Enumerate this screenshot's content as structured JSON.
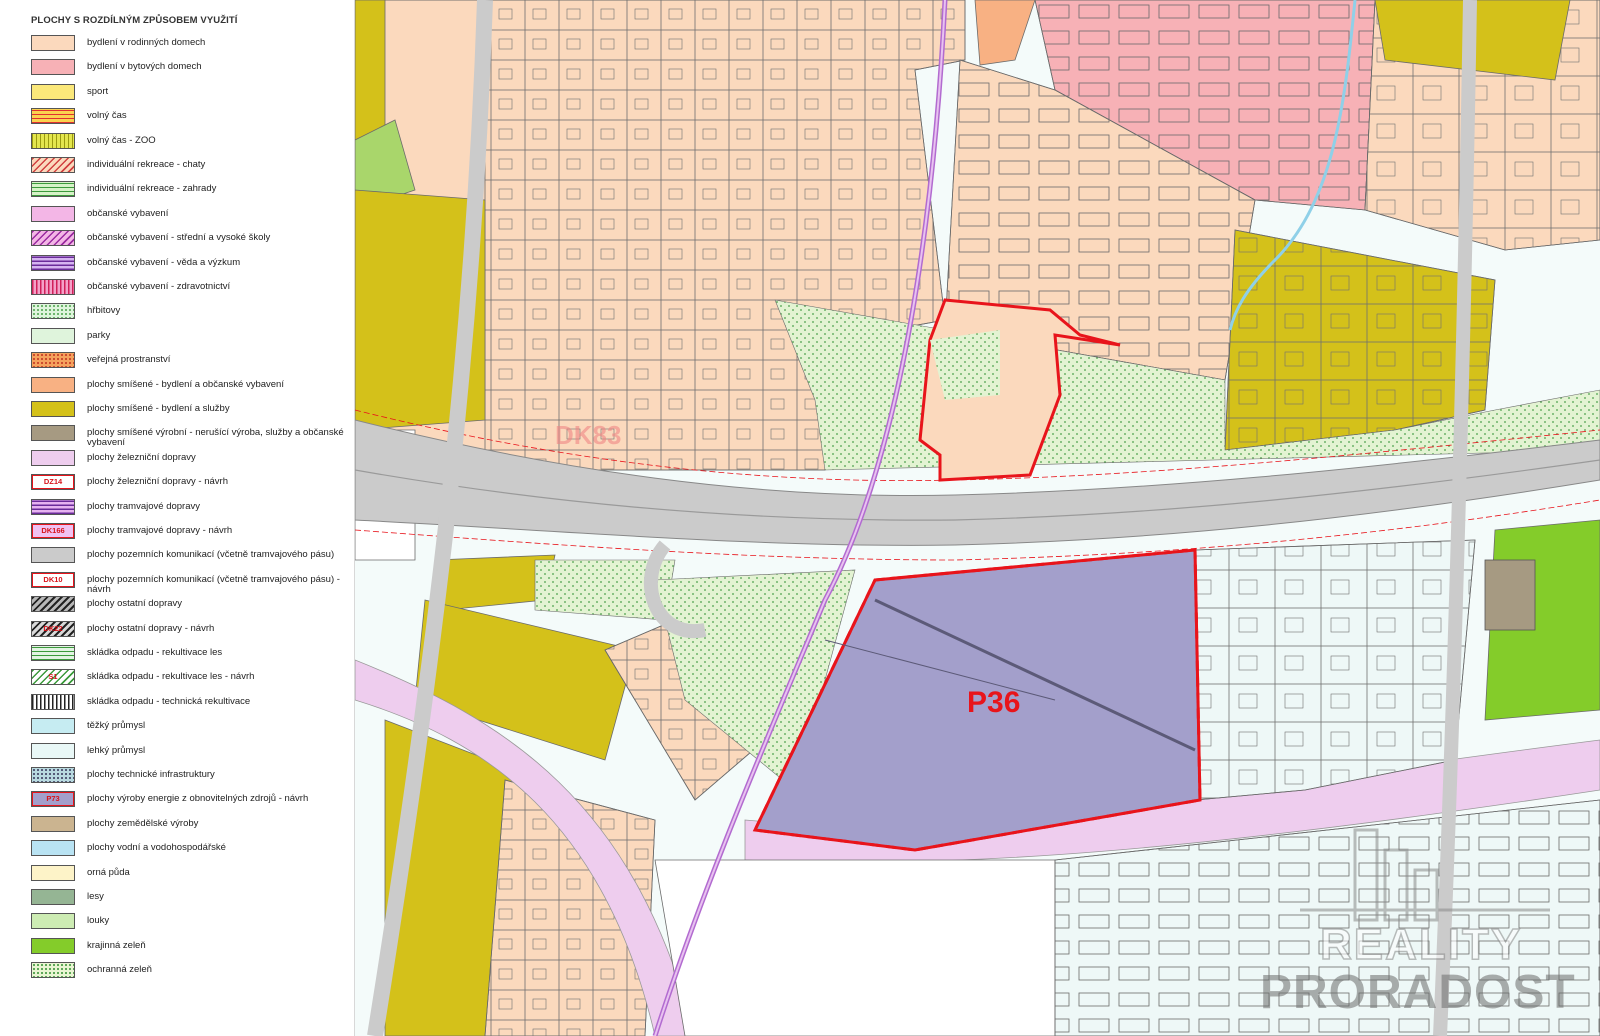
{
  "legend": {
    "title": "PLOCHY S ROZDÍLNÝM ZPŮSOBEM VYUŽITÍ",
    "items": [
      {
        "label": "bydlení v rodinných domech",
        "fill": "#fbd9bd",
        "pattern": "none",
        "code": ""
      },
      {
        "label": "bydlení v bytových domech",
        "fill": "#f7b1b6",
        "pattern": "none",
        "code": ""
      },
      {
        "label": "sport",
        "fill": "#fbe87a",
        "pattern": "none",
        "code": ""
      },
      {
        "label": "volný čas",
        "fill": "#fbd24f",
        "pattern": "hstripe-red",
        "code": ""
      },
      {
        "label": "volný čas - ZOO",
        "fill": "#e4e64e",
        "pattern": "vstripe",
        "code": ""
      },
      {
        "label": "individuální rekreace - chaty",
        "fill": "#fbd9bd",
        "pattern": "diag-red",
        "code": ""
      },
      {
        "label": "individuální rekreace - zahrady",
        "fill": "#d6f2c7",
        "pattern": "hstripe-green",
        "code": ""
      },
      {
        "label": "občanské vybavení",
        "fill": "#f3b6e6",
        "pattern": "none",
        "code": ""
      },
      {
        "label": "občanské vybavení - střední a vysoké školy",
        "fill": "#f3b6e6",
        "pattern": "diag-purple",
        "code": ""
      },
      {
        "label": "občanské vybavení - věda a výzkum",
        "fill": "#d5b3f0",
        "pattern": "hstripe-purple",
        "code": ""
      },
      {
        "label": "občanské vybavení  - zdravotnictví",
        "fill": "#f4a1c8",
        "pattern": "vstripe-red",
        "code": ""
      },
      {
        "label": "hřbitovy",
        "fill": "#dff4dc",
        "pattern": "dots",
        "code": ""
      },
      {
        "label": "parky",
        "fill": "#dff4dc",
        "pattern": "none",
        "code": ""
      },
      {
        "label": "veřejná prostranství",
        "fill": "#f5a25d",
        "pattern": "dots-red",
        "code": ""
      },
      {
        "label": "plochy smíšené - bydlení a občanské vybavení",
        "fill": "#f8b183",
        "pattern": "none",
        "code": ""
      },
      {
        "label": "plochy smíšené - bydlení a služby",
        "fill": "#d4c11a",
        "pattern": "none",
        "code": ""
      },
      {
        "label": "plochy smíšené výrobní - nerušící výroba, služby a občanské vybavení",
        "fill": "#a69a82",
        "pattern": "none",
        "code": ""
      },
      {
        "label": "plochy železniční dopravy",
        "fill": "#eecdee",
        "pattern": "none",
        "code": ""
      },
      {
        "label": "plochy železniční dopravy - návrh",
        "fill": "#ffffff",
        "pattern": "border-red",
        "code": "DZ14"
      },
      {
        "label": "plochy tramvajové dopravy",
        "fill": "#e6b2f0",
        "pattern": "hstripe-purple",
        "code": ""
      },
      {
        "label": "plochy tramvajové dopravy - návrh",
        "fill": "#f0c2f2",
        "pattern": "border-red",
        "code": "DK166"
      },
      {
        "label": "plochy pozemních komunikací (včetně tramvajového pásu)",
        "fill": "#cbcbcb",
        "pattern": "none",
        "code": ""
      },
      {
        "label": "plochy pozemních komunikací (včetně tramvajového pásu) - návrh",
        "fill": "#ffffff",
        "pattern": "border-red",
        "code": "DK10"
      },
      {
        "label": "plochy ostatní dopravy",
        "fill": "#b8b8b8",
        "pattern": "diag-dark",
        "code": ""
      },
      {
        "label": "plochy ostatní dopravy - návrh",
        "fill": "#d8d8d8",
        "pattern": "diag-dark",
        "code": "DK22"
      },
      {
        "label": "skládka odpadu - rekultivace les",
        "fill": "#e3f4e3",
        "pattern": "hstripe-green",
        "code": ""
      },
      {
        "label": "skládka odpadu - rekultivace les - návrh",
        "fill": "#ffffff",
        "pattern": "diag-green",
        "code": "S1"
      },
      {
        "label": "skládka odpadu - technická rekultivace",
        "fill": "#ffffff",
        "pattern": "vstripe-dark",
        "code": ""
      },
      {
        "label": "těžký průmysl",
        "fill": "#c6ecf2",
        "pattern": "none",
        "code": ""
      },
      {
        "label": "lehký průmysl",
        "fill": "#e9f8f7",
        "pattern": "none",
        "code": ""
      },
      {
        "label": "plochy technické infrastruktury",
        "fill": "#b8d9df",
        "pattern": "dots-dark",
        "code": ""
      },
      {
        "label": "plochy výroby energie z obnovitelných zdrojů - návrh",
        "fill": "#a39fcb",
        "pattern": "border-red",
        "code": "P73"
      },
      {
        "label": "plochy zemědělské výroby",
        "fill": "#cbb490",
        "pattern": "none",
        "code": ""
      },
      {
        "label": "plochy vodní a vodohospodářské",
        "fill": "#b9e3f3",
        "pattern": "none",
        "code": ""
      },
      {
        "label": "orná půda",
        "fill": "#fdf3c8",
        "pattern": "none",
        "code": ""
      },
      {
        "label": "lesy",
        "fill": "#95b594",
        "pattern": "none",
        "code": ""
      },
      {
        "label": "louky",
        "fill": "#cdecb3",
        "pattern": "none",
        "code": ""
      },
      {
        "label": "krajinná zeleň",
        "fill": "#84cc2a",
        "pattern": "none",
        "code": ""
      },
      {
        "label": "ochranná zeleň",
        "fill": "#e9f5d2",
        "pattern": "dots-green",
        "code": ""
      }
    ]
  },
  "map": {
    "labels": {
      "dk83": "DK83",
      "p36": "P36"
    },
    "colors": {
      "residential": "#fbd9bd",
      "apartment": "#f7b1b6",
      "mixed_services": "#d4c11a",
      "road": "#cbcbcb",
      "rail": "#eecdee",
      "tram": "#c58ad8",
      "protective_green": "#e3f3d2",
      "light_industry": "#eef8f7",
      "energy_proposal": "#a39fcb",
      "landscape_green": "#84cc2a",
      "mixed_residential_civic": "#f8b183",
      "sport": "#ebe24f",
      "outline_red": "#e8141b"
    }
  },
  "watermark": {
    "line1": "REALITY",
    "line2": "PRORADOST"
  }
}
